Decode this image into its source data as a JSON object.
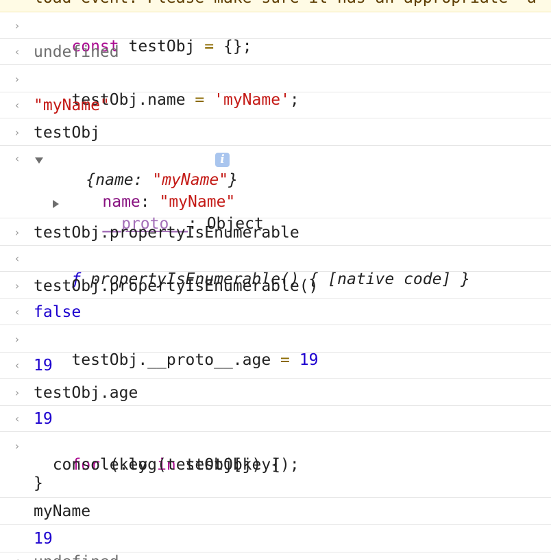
{
  "warning_text": "load event. Please make sure it has an appropriate `a",
  "entries": {
    "e1": {
      "kw": "const",
      "var": "testObj",
      "op": "=",
      "rest": "{};"
    },
    "r1": "undefined",
    "e2": {
      "lhs": "testObj.name",
      "op": "=",
      "str": "'myName'",
      "semi": ";"
    },
    "r2": "\"myName\"",
    "e3": "testObj",
    "r3": {
      "summary_open": "{",
      "summary_key": "name: ",
      "summary_val": "\"myName\"",
      "summary_close": "}",
      "prop_key": "name",
      "prop_colon": ": ",
      "prop_val": "\"myName\"",
      "proto_key": "__proto__",
      "proto_val": ": Object"
    },
    "e4": "testObj.propertyIsEnumerable",
    "r4": {
      "f": "ƒ",
      "rest": "propertyIsEnumerable() { [native code] }"
    },
    "e5": "testObj.propertyIsEnumerable()",
    "r5": "false",
    "e6": {
      "lhs": "testObj.__proto__.age",
      "op": "=",
      "num": "19"
    },
    "r6": "19",
    "e7": "testObj.age",
    "r7": "19",
    "e8": {
      "kw1": "for",
      "p1": " (key ",
      "kw2": "in",
      "p2": " testObj) {",
      "line2": "  console.log(testObj[key]);",
      "line3": "}"
    },
    "log1": "myName",
    "log2": "19",
    "tail": "undefined"
  },
  "icons": {
    "prompt": "chevron-right-icon",
    "result": "return-arrow-icon",
    "info": "info-icon"
  }
}
